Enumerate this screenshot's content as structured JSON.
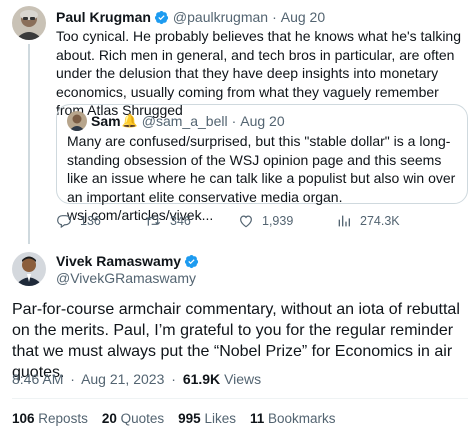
{
  "parent_tweet": {
    "author_name": "Paul Krugman",
    "handle": "@paulkrugman",
    "separator": "·",
    "date": "Aug 20",
    "text": "Too cynical. He probably believes that he knows what he's talking about. Rich men in general, and tech bros in particular, are often under the delusion that they have deep insights into monetary economics, usually coming from what they vaguely remember from Atlas Shrugged",
    "quoted": {
      "author_name": "Sam",
      "emoji": "🔔",
      "handle": "@sam_a_bell",
      "separator": "·",
      "date": "Aug 20",
      "text": "Many are confused/surprised, but this \"stable dollar\" is a long-standing obsession of the WSJ opinion page and this seems like an issue where he can talk like a populist but also win over an important elite conservative media organ. wsj.com/articles/vivek..."
    },
    "actions": {
      "replies": "136",
      "reposts": "346",
      "likes": "1,939",
      "views": "274.3K"
    }
  },
  "main_tweet": {
    "author_name": "Vivek Ramaswamy",
    "handle": "@VivekGRamaswamy",
    "text": "Par-for-course armchair commentary, without an iota of rebuttal on the merits. Paul, I’m grateful to you for the regular reminder that we must always put the “Nobel Prize” for Economics in air quotes.",
    "time": "8:46 AM",
    "separator": "·",
    "date": "Aug 21, 2023",
    "separator2": "·",
    "views_count": "61.9K",
    "views_label": "Views",
    "stats": {
      "reposts_count": "106",
      "reposts_label": "Reposts",
      "quotes_count": "20",
      "quotes_label": "Quotes",
      "likes_count": "995",
      "likes_label": "Likes",
      "bookmarks_count": "11",
      "bookmarks_label": "Bookmarks"
    }
  },
  "colors": {
    "text": "#0f1419",
    "muted": "#536471",
    "verified": "#1d9bf0",
    "border": "#cfd9de"
  },
  "icons": [
    "verified-badge-icon",
    "reply-icon",
    "repost-icon",
    "like-icon",
    "views-icon"
  ]
}
